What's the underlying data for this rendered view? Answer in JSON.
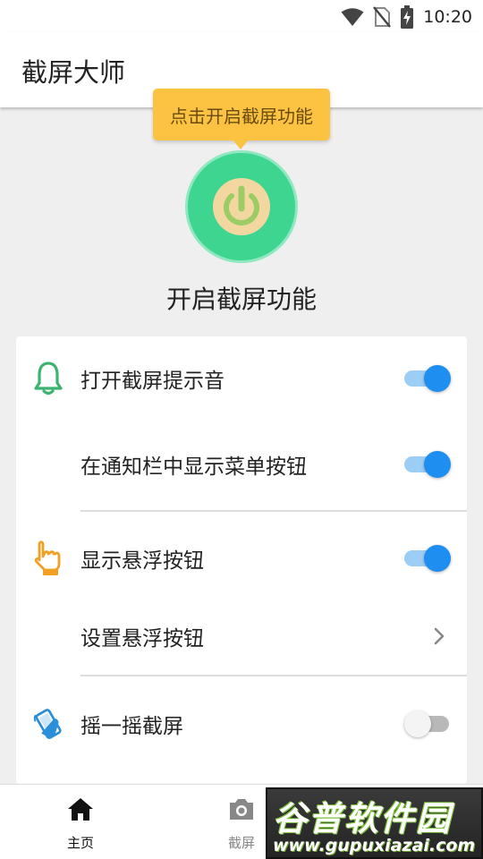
{
  "status_bar": {
    "time": "10:20"
  },
  "app_bar": {
    "title": "截屏大师"
  },
  "hero": {
    "tooltip": "点击开启截屏功能",
    "label": "开启截屏功能",
    "button_color": "#3dd590"
  },
  "settings": {
    "items": [
      {
        "label": "打开截屏提示音",
        "icon": "bell-icon",
        "control": "switch",
        "on": true
      },
      {
        "label": "在通知栏中显示菜单按钮",
        "icon": "",
        "control": "switch",
        "on": true
      },
      {
        "label": "显示悬浮按钮",
        "icon": "hand-pointer-icon",
        "control": "switch",
        "on": true
      },
      {
        "label": "设置悬浮按钮",
        "icon": "",
        "control": "chevron"
      },
      {
        "label": "摇一摇截屏",
        "icon": "shake-phone-icon",
        "control": "switch",
        "on": false
      }
    ],
    "accent_color": "#1e8ff0"
  },
  "bottom_nav": {
    "items": [
      {
        "label": "主页",
        "icon": "home-icon",
        "active": true
      },
      {
        "label": "截屏",
        "icon": "camera-icon",
        "active": false
      }
    ]
  },
  "watermark": {
    "title": "谷普软件园",
    "url": "www.gupuxiazai.com"
  }
}
